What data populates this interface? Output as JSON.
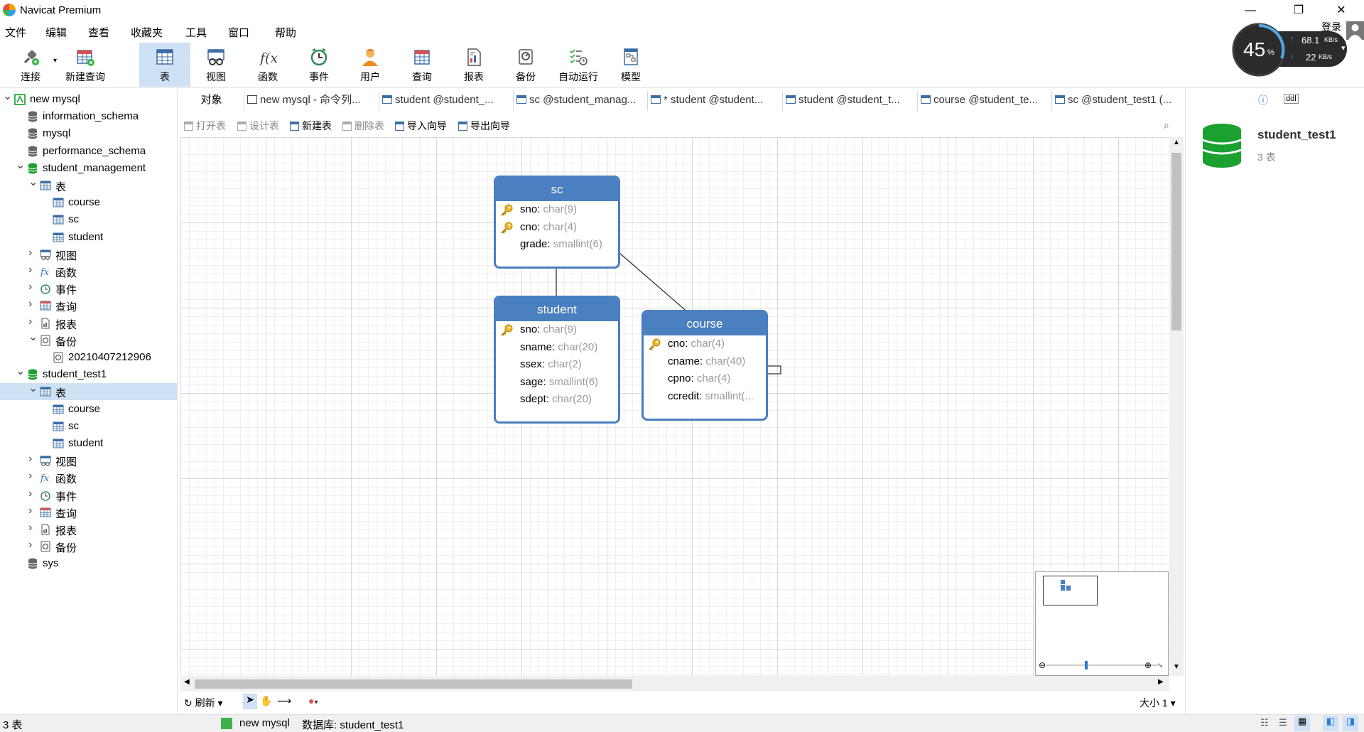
{
  "app": {
    "title": "Navicat Premium"
  },
  "window": {
    "minimize": "—",
    "maximize": "❐",
    "close": "✕",
    "login": "登录"
  },
  "menu": [
    "文件",
    "编辑",
    "查看",
    "收藏夹",
    "工具",
    "窗口",
    "帮助"
  ],
  "toolbar": {
    "connect": "连接",
    "new_query": "新建查询",
    "table": "表",
    "view": "视图",
    "function": "函数",
    "event": "事件",
    "user": "用户",
    "query": "查询",
    "report": "报表",
    "backup": "备份",
    "autorun": "自动运行",
    "model": "模型"
  },
  "sidebar": {
    "items": [
      {
        "label": "new mysql"
      },
      {
        "label": "information_schema"
      },
      {
        "label": "mysql"
      },
      {
        "label": "performance_schema"
      },
      {
        "label": "student_management"
      },
      {
        "label": "表"
      },
      {
        "label": "course"
      },
      {
        "label": "sc"
      },
      {
        "label": "student"
      },
      {
        "label": "视图"
      },
      {
        "label": "函数"
      },
      {
        "label": "事件"
      },
      {
        "label": "查询"
      },
      {
        "label": "报表"
      },
      {
        "label": "备份"
      },
      {
        "label": "20210407212906"
      },
      {
        "label": "student_test1"
      },
      {
        "label": "表"
      },
      {
        "label": "course"
      },
      {
        "label": "sc"
      },
      {
        "label": "student"
      },
      {
        "label": "视图"
      },
      {
        "label": "函数"
      },
      {
        "label": "事件"
      },
      {
        "label": "查询"
      },
      {
        "label": "报表"
      },
      {
        "label": "备份"
      },
      {
        "label": "sys"
      }
    ]
  },
  "tabs": [
    {
      "label": "对象"
    },
    {
      "label": "new mysql - 命令列..."
    },
    {
      "label": "student @student_..."
    },
    {
      "label": "sc @student_manag..."
    },
    {
      "label": "* student @student..."
    },
    {
      "label": "student @student_t..."
    },
    {
      "label": "course @student_te..."
    },
    {
      "label": "sc @student_test1 (..."
    }
  ],
  "objbar": {
    "open": "打开表",
    "design": "设计表",
    "new": "新建表",
    "delete": "删除表",
    "import": "导入向导",
    "export": "导出向导"
  },
  "er": {
    "sc": {
      "name": "sc",
      "fields": [
        {
          "name": "sno",
          "type": "char(9)",
          "key": true
        },
        {
          "name": "cno",
          "type": "char(4)",
          "key": true
        },
        {
          "name": "grade",
          "type": "smallint(6)",
          "key": false
        }
      ]
    },
    "student": {
      "name": "student",
      "fields": [
        {
          "name": "sno",
          "type": "char(9)",
          "key": true
        },
        {
          "name": "sname",
          "type": "char(20)",
          "key": false
        },
        {
          "name": "ssex",
          "type": "char(2)",
          "key": false
        },
        {
          "name": "sage",
          "type": "smallint(6)",
          "key": false
        },
        {
          "name": "sdept",
          "type": "char(20)",
          "key": false
        }
      ]
    },
    "course": {
      "name": "course",
      "fields": [
        {
          "name": "cno",
          "type": "char(4)",
          "key": true
        },
        {
          "name": "cname",
          "type": "char(40)",
          "key": false
        },
        {
          "name": "cpno",
          "type": "char(4)",
          "key": false
        },
        {
          "name": "ccredit",
          "type": "smallint(...",
          "key": false
        }
      ]
    }
  },
  "canvasbar": {
    "refresh": "刷新",
    "size": "大小 1"
  },
  "status": {
    "count": "3 表",
    "connection": "new mysql",
    "database": "数据库: student_test1"
  },
  "info": {
    "name": "student_test1",
    "count": "3 表"
  },
  "speed": {
    "percent": "45",
    "unit": "%",
    "up": "68.1",
    "up_unit": "KB/s",
    "down": "22",
    "down_unit": "KB/s"
  },
  "colors": {
    "entity": "#4a7fc0",
    "selection": "#cfe1f4",
    "db_green": "#1aa12f"
  }
}
